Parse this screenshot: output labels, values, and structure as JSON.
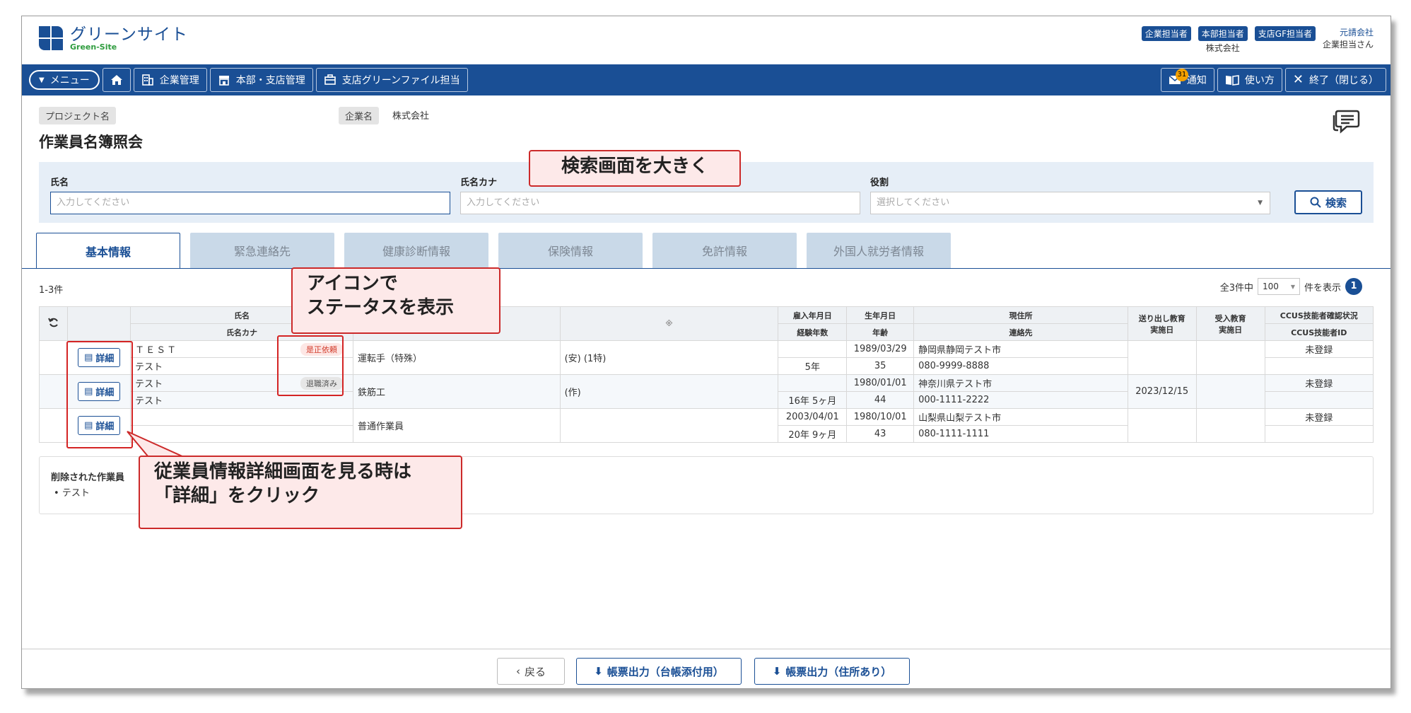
{
  "header": {
    "logo_jp": "グリーンサイト",
    "logo_en": "Green-Site",
    "roles": [
      {
        "badge": "企業担当者",
        "sub": ""
      },
      {
        "badge": "本部担当者",
        "sub": "株式会社"
      },
      {
        "badge": "支店GF担当者",
        "sub": ""
      }
    ],
    "user_company": "元請会社",
    "user_name": "企業担当さん"
  },
  "nav": {
    "menu": "メニュー",
    "home_icon": "home-icon",
    "company": "企業管理",
    "branch": "本部・支店管理",
    "greenfile": "支店グリーンファイル担当",
    "notify": "通知",
    "notify_count": "31",
    "howto": "使い方",
    "close": "終了（閉じる）"
  },
  "page": {
    "project_label": "プロジェクト名",
    "company_label": "企業名",
    "company_value": "株式会社",
    "title": "作業員名簿照会"
  },
  "search": {
    "name_label": "氏名",
    "name_placeholder": "入力してください",
    "kana_label": "氏名カナ",
    "kana_placeholder": "入力してください",
    "role_label": "役割",
    "role_placeholder": "選択してください",
    "button": "検索"
  },
  "tabs": [
    "基本情報",
    "緊急連絡先",
    "健康診断情報",
    "保険情報",
    "免許情報",
    "外国人就労者情報"
  ],
  "list": {
    "range": "1-3件",
    "total": "全3件中",
    "per_page": "100",
    "per_page_suffix": "件を表示",
    "page": "1"
  },
  "table": {
    "headers": {
      "name": "氏名",
      "kana": "氏名カナ",
      "note": "※",
      "hire_date": "雇入年月日",
      "years": "経験年数",
      "birth": "生年月日",
      "age": "年齢",
      "address": "現住所",
      "contact": "連絡先",
      "send_edu": "送り出し教育",
      "send_edu2": "実施日",
      "recv_edu": "受入教育",
      "recv_edu2": "実施日",
      "ccus1": "CCUS技能者確認状況",
      "ccus2": "CCUS技能者ID"
    },
    "detail_label": "詳細",
    "rows": [
      {
        "name": "ＴＥＳＴ",
        "kana": "テスト",
        "status": "是正依頼",
        "job": "運転手（特殊）",
        "note": "(安) (1特)",
        "hire": "",
        "years": "5年",
        "birth": "1989/03/29",
        "age": "35",
        "address": "静岡県静岡テスト市",
        "tel": "080-9999-8888",
        "send": "",
        "recv": "",
        "ccus": "未登録"
      },
      {
        "name": "テスト",
        "kana": "テスト",
        "status": "退職済み",
        "job": "鉄筋工",
        "note": "(作)",
        "hire": "",
        "years": "16年 5ヶ月",
        "birth": "1980/01/01",
        "age": "44",
        "address": "神奈川県テスト市",
        "tel": "000-1111-2222",
        "send": "2023/12/15",
        "recv": "",
        "ccus": "未登録"
      },
      {
        "name": "",
        "kana": "",
        "status": "",
        "job": "普通作業員",
        "note": "",
        "hire": "2003/04/01",
        "years": "20年 9ヶ月",
        "birth": "1980/10/01",
        "age": "43",
        "address": "山梨県山梨テスト市",
        "tel": "080-1111-1111",
        "send": "",
        "recv": "",
        "ccus": "未登録"
      }
    ]
  },
  "deleted": {
    "title": "削除された作業員",
    "items": [
      "テスト"
    ]
  },
  "footer": {
    "back": "戻る",
    "export1": "帳票出力（台帳添付用）",
    "export2": "帳票出力（住所あり）"
  },
  "callouts": {
    "search": "検索画面を大きく",
    "icon_line1": "アイコンで",
    "icon_line2": "ステータスを表示",
    "detail_line1": "従業員情報詳細画面を見る時は",
    "detail_line2": "「詳細」をクリック"
  },
  "colors": {
    "primary": "#1a4f95",
    "callout_border": "#cc2a2a",
    "callout_bg": "#fde9e9"
  }
}
